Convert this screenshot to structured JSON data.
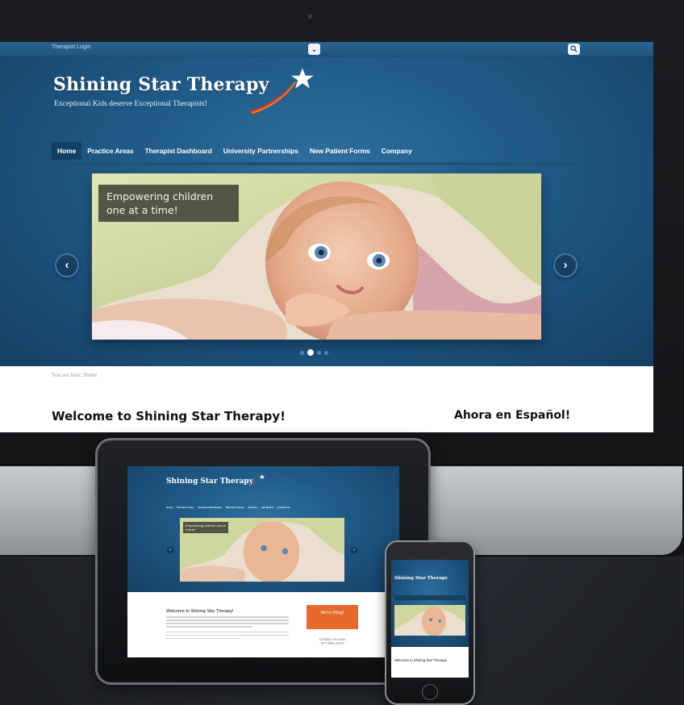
{
  "site": {
    "login_link": "Therapist Login",
    "brand_title": "Shining Star Therapy",
    "tagline": "Exceptional Kids deserve Exceptional Therapists!",
    "nav": [
      {
        "label": "Home",
        "active": true
      },
      {
        "label": "Practice Areas",
        "active": false
      },
      {
        "label": "Therapist Dashboard",
        "active": false
      },
      {
        "label": "University Partnerships",
        "active": false
      },
      {
        "label": "New Patient Forms",
        "active": false
      },
      {
        "label": "Company",
        "active": false
      }
    ],
    "slide_caption": "Empowering children one at a time!",
    "breadcrumb": "You are here: Home",
    "welcome_heading": "Welcome to Shining Star Therapy!",
    "espanol_heading": "Ahora en Español!",
    "slider_dots": 4,
    "active_dot": 1
  },
  "tablet": {
    "brand_title": "Shining Star Therapy",
    "nav": [
      "Home",
      "Practice Areas",
      "Therapist Dashboard",
      "New Pat. Forms",
      "Careers",
      "Job Board",
      "Contact Us"
    ],
    "slide_caption": "Empowering children one at a time!",
    "welcome_heading": "Welcome to Shining Star Therapy!",
    "cta": "We're Hiring!",
    "contact_title": "Contact Us Now",
    "contact_phone": "877-800-1076"
  },
  "phone": {
    "brand_title": "Shining Star Therapy",
    "welcome_heading": "Welcome to Shining Star Therapy!"
  },
  "icons": {
    "topbar_dropdown": "chevron-down-icon",
    "topbar_search": "search-icon",
    "slider_prev": "chevron-left-icon",
    "slider_next": "chevron-right-icon",
    "logo": "star-swoosh-icon"
  },
  "colors": {
    "site_blue": "#1f5a86",
    "nav_active": "#163f61",
    "cta_orange": "#e8692c",
    "swoosh_red": "#d8361c"
  }
}
